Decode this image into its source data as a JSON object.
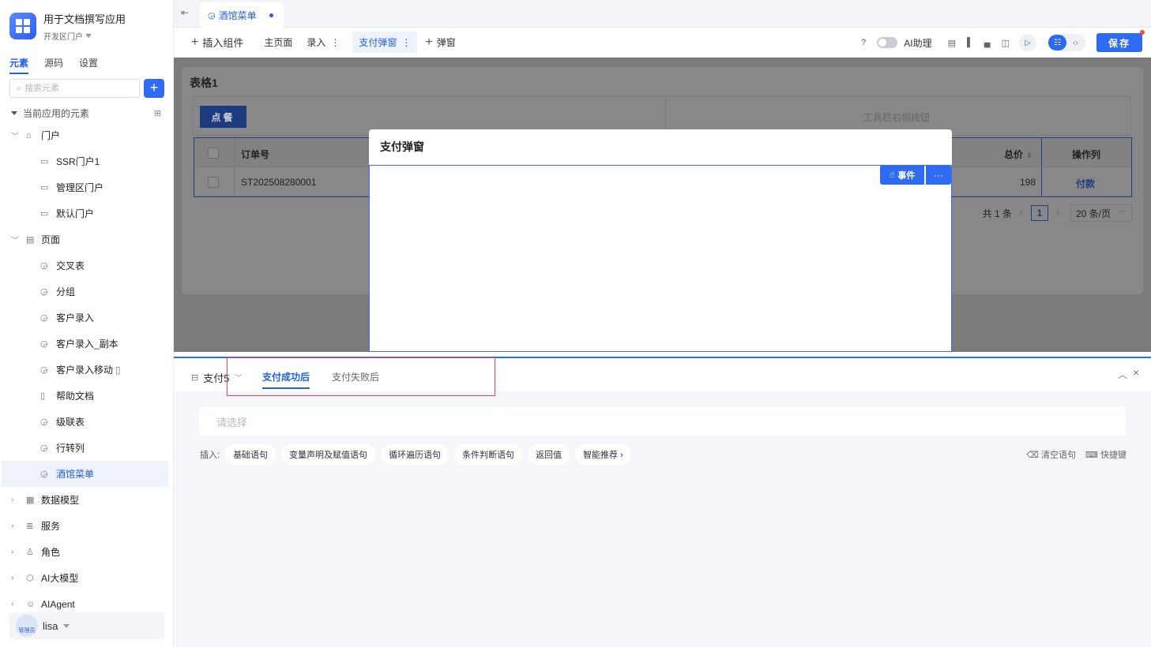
{
  "app": {
    "title": "用于文档撰写应用",
    "portal": "开发区门户"
  },
  "sidebar": {
    "tabs": [
      "元素",
      "源码",
      "设置"
    ],
    "search_placeholder": "搜索元素",
    "add": "+",
    "tree_header": "当前应用的元素",
    "items": [
      {
        "label": "门户",
        "icon": "home-icon",
        "level": 1,
        "expanded": true
      },
      {
        "label": "SSR门户1",
        "icon": "monitor-icon",
        "level": 2
      },
      {
        "label": "管理区门户",
        "icon": "monitor-icon",
        "level": 2
      },
      {
        "label": "默认门户",
        "icon": "monitor-icon",
        "level": 2
      },
      {
        "label": "页面",
        "icon": "page-icon",
        "level": 1,
        "expanded": true
      },
      {
        "label": "交叉表",
        "icon": "page-link-icon",
        "level": 2
      },
      {
        "label": "分组",
        "icon": "page-link-icon",
        "level": 2
      },
      {
        "label": "客户录入",
        "icon": "page-link-icon",
        "level": 2
      },
      {
        "label": "客户录入_副本",
        "icon": "page-link-icon",
        "level": 2
      },
      {
        "label": "客户录入移动",
        "icon": "page-link-icon",
        "level": 2
      },
      {
        "label": "帮助文档",
        "icon": "doc-icon",
        "level": 2
      },
      {
        "label": "级联表",
        "icon": "page-link-icon",
        "level": 2
      },
      {
        "label": "行转列",
        "icon": "page-link-icon",
        "level": 2
      },
      {
        "label": "酒馆菜单",
        "icon": "page-link-icon",
        "level": 2,
        "selected": true
      },
      {
        "label": "数据模型",
        "icon": "table-icon",
        "level": 1
      },
      {
        "label": "服务",
        "icon": "service-icon",
        "level": 1
      },
      {
        "label": "角色",
        "icon": "role-icon",
        "level": 1
      },
      {
        "label": "AI大模型",
        "icon": "cube-icon",
        "level": 1
      },
      {
        "label": "AIAgent",
        "icon": "robot-icon",
        "level": 1
      }
    ],
    "user": {
      "name": "lisa",
      "role_badge": "管理员"
    }
  },
  "tabbar": {
    "doc_tab": "酒馆菜单"
  },
  "toolbar": {
    "insert_component": "插入组件",
    "main_page": "主页面",
    "entry": "录入",
    "payment_popup": "支付弹窗",
    "popup": "弹窗",
    "ai_assistant": "AI助理",
    "save": "保存"
  },
  "canvas": {
    "card_title": "表格1",
    "order_button": "点餐",
    "toolbar_right_label": "工具栏右侧按钮",
    "table": {
      "headers": {
        "order_no": "订单号",
        "total": "总价",
        "actions": "操作列"
      },
      "rows": [
        {
          "order_no": "ST202508280001",
          "total": "198",
          "action": "付款"
        }
      ]
    },
    "pager": {
      "total": "共 1 条",
      "page": "1",
      "size": "20 条/页"
    }
  },
  "modal": {
    "title": "支付弹窗",
    "event_btn": "事件",
    "more_btn": "···"
  },
  "panel": {
    "event_select": "支付5",
    "tabs": [
      "支付成功后",
      "支付失败后"
    ],
    "active_tab": 0,
    "select_placeholder": "请选择",
    "insert_label": "插入:",
    "chips": [
      "基础语句",
      "变量声明及赋值语句",
      "循环遍历语句",
      "条件判断语句",
      "返回值",
      "智能推荐 ›"
    ],
    "clear": "清空语句",
    "shortcut": "快捷键"
  }
}
